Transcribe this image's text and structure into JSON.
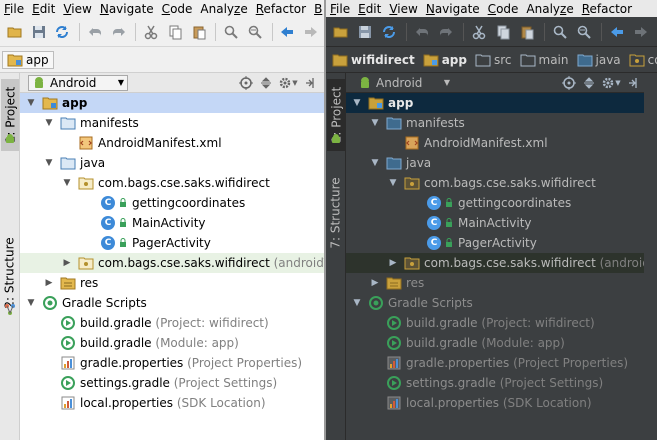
{
  "menu": {
    "items": [
      "File",
      "Edit",
      "View",
      "Navigate",
      "Code",
      "Analyze",
      "Refactor",
      "B"
    ],
    "underline": [
      "F",
      "E",
      "V",
      "N",
      "C",
      "z",
      "R",
      "B"
    ]
  },
  "left": {
    "breadcrumbs": [
      "app"
    ],
    "view_selector": "Android",
    "side_tabs": {
      "project": "1: Project",
      "structure": "2: Structure"
    },
    "tree": [
      {
        "label": "app",
        "secondary": ""
      },
      {
        "label": "manifests",
        "secondary": ""
      },
      {
        "label": "AndroidManifest.xml",
        "secondary": ""
      },
      {
        "label": "java",
        "secondary": ""
      },
      {
        "label": "com.bags.cse.saks.wifidirect",
        "secondary": ""
      },
      {
        "label": "gettingcoordinates",
        "secondary": ""
      },
      {
        "label": "MainActivity",
        "secondary": ""
      },
      {
        "label": "PagerActivity",
        "secondary": ""
      },
      {
        "label": "com.bags.cse.saks.wifidirect",
        "secondary": "(androidTest"
      },
      {
        "label": "res",
        "secondary": ""
      },
      {
        "label": "Gradle Scripts",
        "secondary": ""
      },
      {
        "label": "build.gradle",
        "secondary": "(Project: wifidirect)"
      },
      {
        "label": "build.gradle",
        "secondary": "(Module: app)"
      },
      {
        "label": "gradle.properties",
        "secondary": "(Project Properties)"
      },
      {
        "label": "settings.gradle",
        "secondary": "(Project Settings)"
      },
      {
        "label": "local.properties",
        "secondary": "(SDK Location)"
      }
    ]
  },
  "right": {
    "breadcrumbs": [
      "wifidirect",
      "app",
      "src",
      "main",
      "java",
      "com"
    ],
    "view_selector": "Android",
    "side_tabs": {
      "project": "1: Project",
      "structure": "7: Structure"
    },
    "tree": [
      {
        "label": "app",
        "secondary": ""
      },
      {
        "label": "manifests",
        "secondary": ""
      },
      {
        "label": "AndroidManifest.xml",
        "secondary": ""
      },
      {
        "label": "java",
        "secondary": ""
      },
      {
        "label": "com.bags.cse.saks.wifidirect",
        "secondary": ""
      },
      {
        "label": "gettingcoordinates",
        "secondary": ""
      },
      {
        "label": "MainActivity",
        "secondary": ""
      },
      {
        "label": "PagerActivity",
        "secondary": ""
      },
      {
        "label": "com.bags.cse.saks.wifidirect",
        "secondary": "(androidTest"
      },
      {
        "label": "res",
        "secondary": ""
      },
      {
        "label": "Gradle Scripts",
        "secondary": ""
      },
      {
        "label": "build.gradle",
        "secondary": "(Project: wifidirect)"
      },
      {
        "label": "build.gradle",
        "secondary": "(Module: app)"
      },
      {
        "label": "gradle.properties",
        "secondary": "(Project Properties)"
      },
      {
        "label": "settings.gradle",
        "secondary": "(Project Settings)"
      },
      {
        "label": "local.properties",
        "secondary": "(SDK Location)"
      }
    ]
  },
  "colors": {
    "light_bg": "#ffffff",
    "dark_bg": "#3c3f41",
    "selection_light": "#c4d7f6",
    "selection_dark": "#0d293e",
    "folder_blue": "#5b8fc7",
    "package_yellow": "#d9b44a",
    "class_blue": "#3d8ad8",
    "gradle_green": "#3aa05a"
  }
}
